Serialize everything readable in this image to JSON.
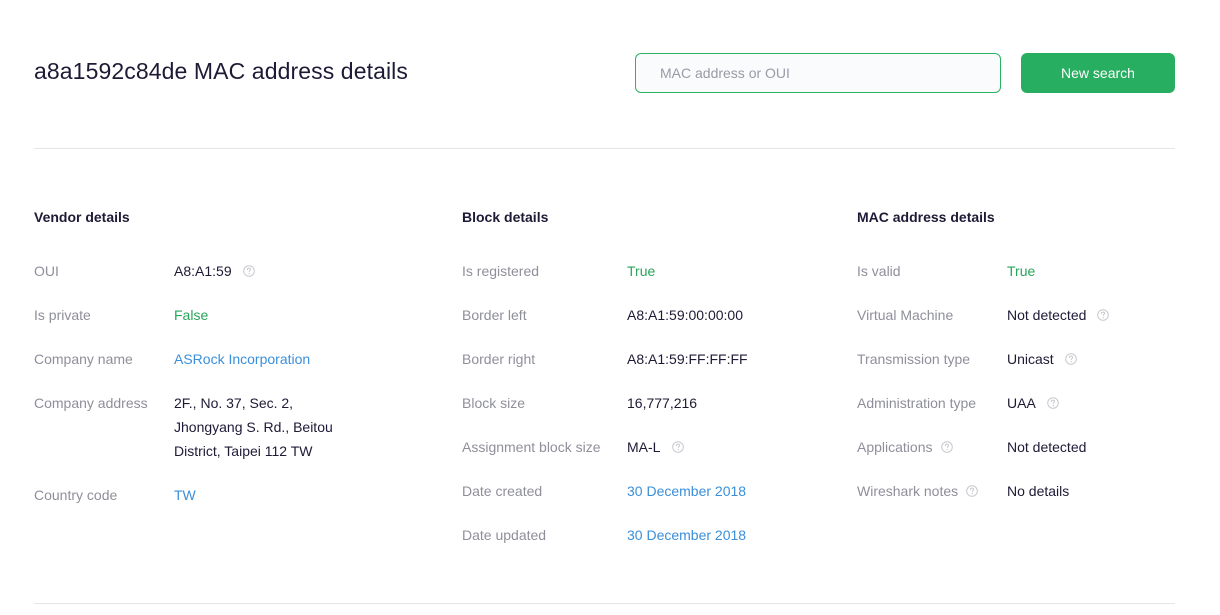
{
  "header": {
    "title": "a8a1592c84de MAC address details",
    "search_placeholder": "MAC address or OUI",
    "search_button": "New search"
  },
  "colors": {
    "accent": "#28ae60",
    "true_green": "#28a55a",
    "link_blue": "#3b8fd9",
    "label_gray": "#8f8f9b"
  },
  "vendor": {
    "title": "Vendor details",
    "oui_label": "OUI",
    "oui_value": "A8:A1:59",
    "private_label": "Is private",
    "private_value": "False",
    "company_label": "Company name",
    "company_value": "ASRock Incorporation",
    "address_label": "Company address",
    "address_lines": [
      "2F., No. 37, Sec. 2,",
      "Jhongyang S. Rd., Beitou",
      "District, Taipei 112 TW"
    ],
    "country_label": "Country code",
    "country_value": "TW"
  },
  "block": {
    "title": "Block details",
    "registered_label": "Is registered",
    "registered_value": "True",
    "border_left_label": "Border left",
    "border_left_value": "A8:A1:59:00:00:00",
    "border_right_label": "Border right",
    "border_right_value": "A8:A1:59:FF:FF:FF",
    "size_label": "Block size",
    "size_value": "16,777,216",
    "assignment_label": "Assignment block size",
    "assignment_value": "MA-L",
    "created_label": "Date created",
    "created_value": "30 December 2018",
    "updated_label": "Date updated",
    "updated_value": "30 December 2018"
  },
  "mac": {
    "title": "MAC address details",
    "valid_label": "Is valid",
    "valid_value": "True",
    "vm_label": "Virtual Machine",
    "vm_value": "Not detected",
    "transmission_label": "Transmission type",
    "transmission_value": "Unicast",
    "admin_label": "Administration type",
    "admin_value": "UAA",
    "applications_label": "Applications",
    "applications_value": "Not detected",
    "wireshark_label": "Wireshark notes",
    "wireshark_value": "No details"
  }
}
